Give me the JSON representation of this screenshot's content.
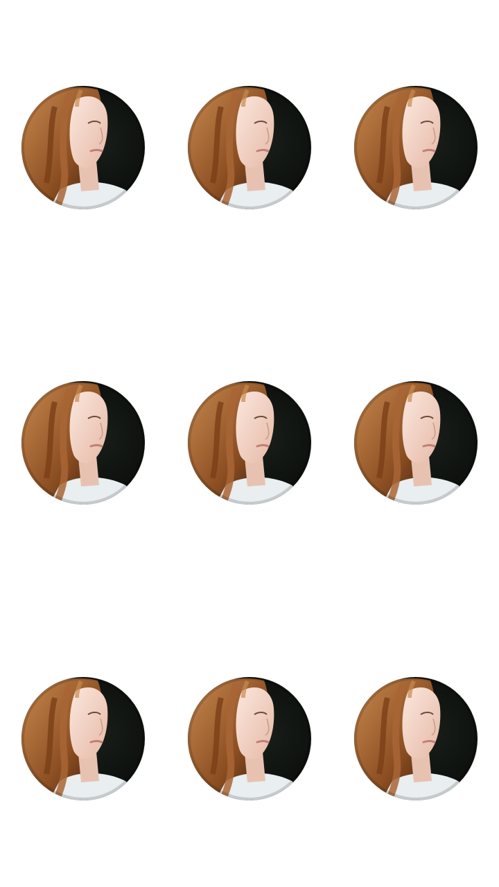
{
  "canvas": {
    "background": "#ffffff"
  },
  "photos": [
    {
      "subject": "portrait-photo"
    },
    {
      "subject": "portrait-photo"
    },
    {
      "subject": "portrait-photo"
    },
    {
      "subject": "portrait-photo"
    },
    {
      "subject": "portrait-photo"
    },
    {
      "subject": "portrait-photo"
    },
    {
      "subject": "portrait-photo"
    },
    {
      "subject": "portrait-photo"
    },
    {
      "subject": "portrait-photo"
    }
  ],
  "palette": {
    "background_dark": "#0b0f0c",
    "hair": "#9a5a2a",
    "hair_highlight": "#c98a4f",
    "skin": "#f3d9cc",
    "shirt": "#e9eef0"
  }
}
